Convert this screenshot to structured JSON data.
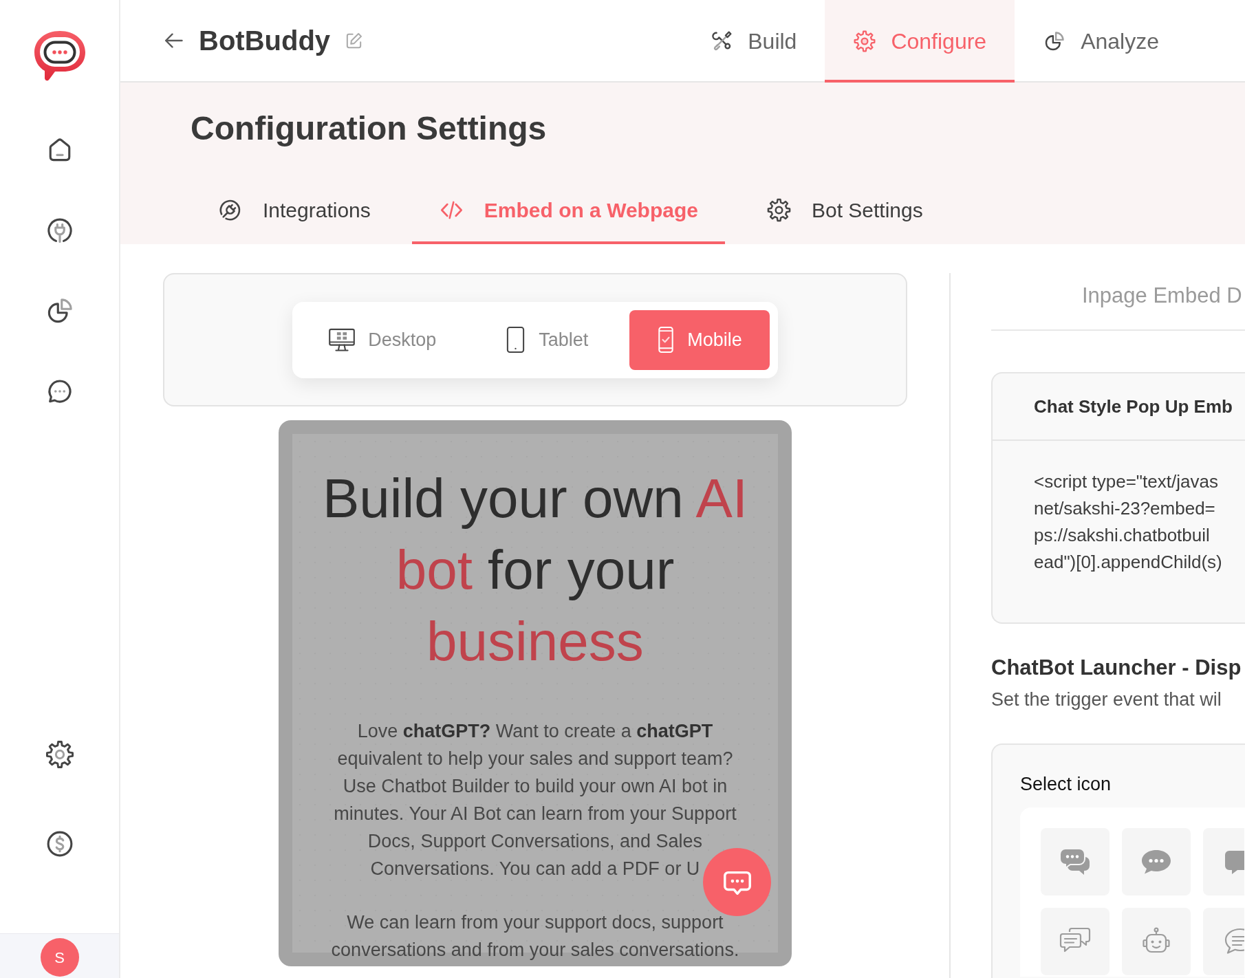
{
  "sidebar": {
    "top_items": [
      {
        "kind": "home"
      },
      {
        "kind": "plug"
      },
      {
        "kind": "pie"
      },
      {
        "kind": "chat"
      }
    ],
    "bottom_items": [
      {
        "kind": "gear"
      },
      {
        "kind": "dollar"
      }
    ],
    "avatar": {
      "initial": "S"
    }
  },
  "header": {
    "title": "BotBuddy",
    "tabs": [
      {
        "label": "Build",
        "kind": "tools",
        "selected": false
      },
      {
        "label": "Configure",
        "kind": "gear",
        "selected": true
      },
      {
        "label": "Analyze",
        "kind": "pie",
        "selected": false
      }
    ]
  },
  "config": {
    "title": "Configuration Settings",
    "tabs": [
      {
        "label": "Integrations",
        "kind": "plug",
        "selected": false
      },
      {
        "label": "Embed on a Webpage",
        "kind": "code",
        "selected": true
      },
      {
        "label": "Bot Settings",
        "kind": "gear",
        "selected": false
      }
    ]
  },
  "devices": [
    {
      "label": "Desktop",
      "kind": "desktop",
      "selected": false
    },
    {
      "label": "Tablet",
      "kind": "tablet",
      "selected": false
    },
    {
      "label": "Mobile",
      "kind": "mobile",
      "selected": true
    }
  ],
  "preview": {
    "heading_lines": [
      {
        "segments": [
          {
            "text": "Build your own ",
            "highlight": false
          },
          {
            "text": "AI",
            "highlight": true
          }
        ]
      },
      {
        "segments": [
          {
            "text": "bot",
            "highlight": true
          },
          {
            "text": " for your",
            "highlight": false
          }
        ]
      },
      {
        "segments": [
          {
            "text": "business",
            "highlight": true
          }
        ]
      }
    ],
    "paragraphs": [
      {
        "lines": [
          "Love **chatGPT?** Want to create a **chatGPT**",
          "equivalent to help your sales and support team?",
          "Use Chatbot Builder to build your own AI bot in",
          "minutes. Your AI Bot can learn from your Support",
          "Docs, Support Conversations, and Sales",
          "Conversations. You can add a PDF or U"
        ]
      },
      {
        "lines": [
          "We can learn from your support docs, support",
          "conversations and from your sales conversations."
        ]
      }
    ]
  },
  "embed": {
    "tab_label": "Inpage Embed D",
    "snippet": {
      "title": "Chat Style Pop Up Emb",
      "code_lines": [
        "<script type=\"text/javas",
        "net/sakshi-23?embed=",
        "ps://sakshi.chatbotbuil",
        "ead\")[0].appendChild(s)"
      ]
    },
    "launcher": {
      "title": "ChatBot Launcher - Disp",
      "description": "Set the trigger event that wil",
      "select_label": "Select icon",
      "icons": [
        {
          "kind": "bubbles"
        },
        {
          "kind": "bubble"
        },
        {
          "kind": "block"
        },
        {
          "kind": "threads"
        },
        {
          "kind": "robot"
        },
        {
          "kind": "comment"
        }
      ]
    }
  }
}
